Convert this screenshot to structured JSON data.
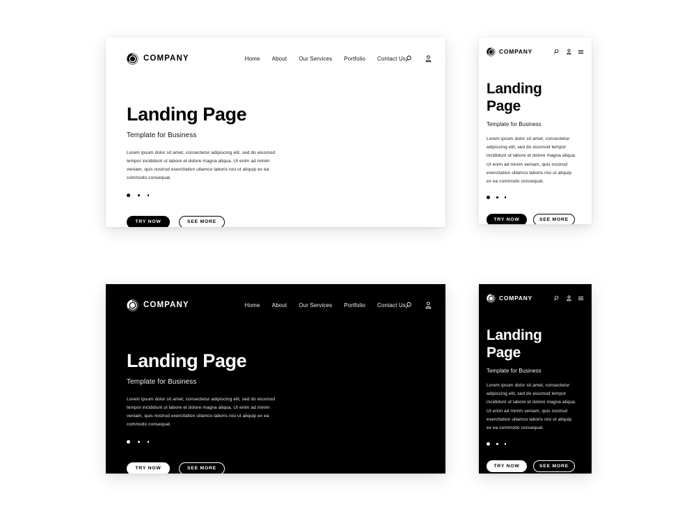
{
  "brand": {
    "name": "COMPANY",
    "logo_icon": "circular-swirl-logo"
  },
  "nav": {
    "items": [
      {
        "label": "Home"
      },
      {
        "label": "About"
      },
      {
        "label": "Our Services"
      },
      {
        "label": "Portfolio"
      },
      {
        "label": "Contact Us"
      }
    ]
  },
  "header_icons": {
    "search": "search-icon",
    "account": "user-icon",
    "menu": "hamburger-menu-icon"
  },
  "hero": {
    "title": "Landing Page",
    "title_line1": "Landing",
    "title_line2": "Page",
    "subtitle": "Template for Business",
    "body": "Lorem ipsum dolor sit amet, consectetur adipiscing elit, sed do eiusmod tempor incididunt ut labore et dolore magna aliqua. Ut enim ad minim veniam, quis nostrud exercitation ullamco laboris nisi ut aliquip ex ea commodo consequat."
  },
  "carousel": {
    "total_dots": 3,
    "active_index": 0
  },
  "buttons": {
    "primary": "TRY NOW",
    "secondary": "SEE MORE"
  },
  "colors": {
    "light_background": "#ffffff",
    "dark_background": "#000000",
    "page_background": "#ffffff",
    "text_on_light": "#000000",
    "text_on_dark": "#ffffff"
  },
  "variants": [
    {
      "name": "desktop-light",
      "theme": "light",
      "device": "desktop"
    },
    {
      "name": "mobile-light",
      "theme": "light",
      "device": "mobile"
    },
    {
      "name": "desktop-dark",
      "theme": "dark",
      "device": "desktop"
    },
    {
      "name": "mobile-dark",
      "theme": "dark",
      "device": "mobile"
    }
  ]
}
